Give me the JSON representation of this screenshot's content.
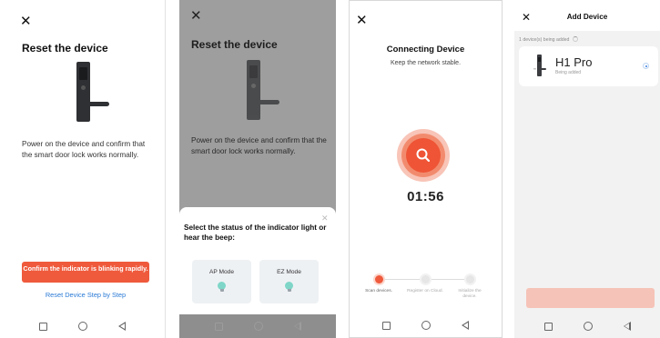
{
  "screen1": {
    "close_glyph": "✕",
    "title": "Reset the device",
    "instruction": "Power on the device and confirm that the smart door lock works normally.",
    "confirm_button": "Confirm the indicator is blinking rapidly.",
    "reset_link": "Reset Device Step by Step"
  },
  "screen2": {
    "close_glyph": "✕",
    "title": "Reset the device",
    "instruction": "Power on the device and confirm that the smart door lock works normally.",
    "sheet_close_glyph": "✕",
    "sheet_title": "Select the status of the indicator light or hear the beep:",
    "modes": [
      "AP Mode",
      "EZ Mode"
    ]
  },
  "screen3": {
    "close_glyph": "✕",
    "title": "Connecting Device",
    "subtitle": "Keep the network stable.",
    "timer": "01:56",
    "steps": [
      "Scan devices.",
      "Register on Cloud.",
      "Initialize the device."
    ],
    "active_step": 0
  },
  "screen4": {
    "close_glyph": "✕",
    "title": "Add Device",
    "status": "1 device(s) being added",
    "device_name": "H1 Pro",
    "device_status": "Being added"
  },
  "colors": {
    "accent": "#ef5a3c",
    "link": "#2a7ad6",
    "overlay": "#9e9e9e",
    "bulb": "#7fd6c8"
  }
}
